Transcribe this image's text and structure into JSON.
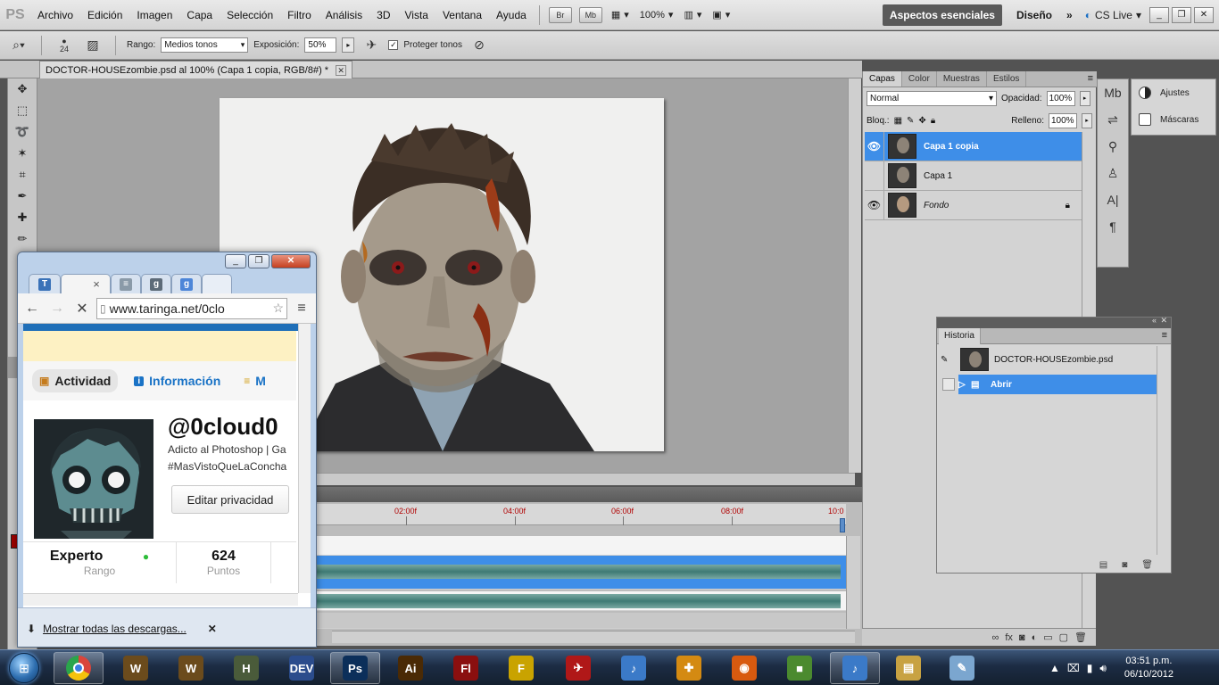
{
  "menubar": {
    "app_logo": "PS",
    "items": [
      "Archivo",
      "Edición",
      "Imagen",
      "Capa",
      "Selección",
      "Filtro",
      "Análisis",
      "3D",
      "Vista",
      "Ventana",
      "Ayuda"
    ],
    "bridge_label": "Br",
    "minibridge_label": "Mb",
    "zoom": "100%",
    "workspace_active": "Aspectos esenciales",
    "workspace_other": "Diseño",
    "more": "»",
    "cs_live": "CS Live"
  },
  "options": {
    "brush_size": "24",
    "range_label": "Rango:",
    "range_value": "Medios tonos",
    "exposure_label": "Exposición:",
    "exposure_value": "50%",
    "protect_label": "Proteger tonos",
    "protect_checked": "✓"
  },
  "document": {
    "tab_title": "DOCTOR-HOUSEzombie.psd al 100% (Capa 1 copia, RGB/8#) *"
  },
  "timeline": {
    "ticks": [
      "02:00f",
      "04:00f",
      "06:00f",
      "08:00f",
      "10:0"
    ]
  },
  "layers_panel": {
    "tabs": [
      "Capas",
      "Color",
      "Muestras",
      "Estilos"
    ],
    "blend_mode": "Normal",
    "opacity_label": "Opacidad:",
    "opacity_value": "100%",
    "lock_label": "Bloq.:",
    "fill_label": "Relleno:",
    "fill_value": "100%",
    "layers": [
      {
        "name": "Capa 1 copia",
        "visible": true,
        "selected": true
      },
      {
        "name": "Capa 1",
        "visible": false,
        "selected": false
      },
      {
        "name": "Fondo",
        "visible": true,
        "selected": false,
        "locked": true
      }
    ]
  },
  "adjust_panel": {
    "ajustes": "Ajustes",
    "mascaras": "Máscaras"
  },
  "history_panel": {
    "tab": "Historia",
    "snapshot": "DOCTOR-HOUSEzombie.psd",
    "steps": [
      "Abrir"
    ]
  },
  "chrome": {
    "url": "www.taringa.net/0clo",
    "tabs": [
      {
        "icon": "T",
        "color": "#3a72b8"
      },
      {
        "icon": "×",
        "color": "#f4f4f4"
      },
      {
        "icon": "≡",
        "color": "#8a9aa8"
      },
      {
        "icon": "g",
        "color": "#5d6b78"
      },
      {
        "icon": "g",
        "color": "#4d86d8"
      }
    ],
    "site_tabs": {
      "activity": "Actividad",
      "info": "Información",
      "more": "M"
    },
    "profile": {
      "username": "@0cloud0",
      "bio_line1": "Adicto al Photoshop | Ga",
      "bio_line2": "#MasVistoQueLaConcha",
      "edit_button": "Editar privacidad",
      "rank_value": "Experto",
      "rank_label": "Rango",
      "points_value": "624",
      "points_label": "Puntos"
    },
    "downloads_link": "Mostrar todas las descargas..."
  },
  "taskbar": {
    "apps": [
      {
        "name": "chrome",
        "label": "",
        "color": "#d9453b",
        "open": true
      },
      {
        "name": "wow-1",
        "label": "W",
        "color": "#6b4b1c",
        "open": false
      },
      {
        "name": "wow-2",
        "label": "W",
        "color": "#6b4b1c",
        "open": false
      },
      {
        "name": "halo",
        "label": "H",
        "color": "#4a5b3a",
        "open": false
      },
      {
        "name": "devcpp",
        "label": "DEV",
        "color": "#2b4c8c",
        "open": false
      },
      {
        "name": "photoshop",
        "label": "Ps",
        "color": "#0c2f5a",
        "open": true
      },
      {
        "name": "illustrator",
        "label": "Ai",
        "color": "#4a2a05",
        "open": false
      },
      {
        "name": "flash",
        "label": "Fl",
        "color": "#8a0f0f",
        "open": false
      },
      {
        "name": "fraps",
        "label": "F",
        "color": "#c9a300",
        "open": false
      },
      {
        "name": "red-app",
        "label": "✈",
        "color": "#b01818",
        "open": false
      },
      {
        "name": "itunes-1",
        "label": "♪",
        "color": "#3b7ac8",
        "open": false
      },
      {
        "name": "gamepad",
        "label": "✚",
        "color": "#d48a12",
        "open": false
      },
      {
        "name": "firefox",
        "label": "◉",
        "color": "#d85a0f",
        "open": false
      },
      {
        "name": "minecraft",
        "label": "■",
        "color": "#4b8a2f",
        "open": false
      },
      {
        "name": "itunes-2",
        "label": "♪",
        "color": "#3b7ac8",
        "open": true
      },
      {
        "name": "explorer",
        "label": "▤",
        "color": "#c8a242",
        "open": false
      },
      {
        "name": "paint",
        "label": "✎",
        "color": "#7ba6cf",
        "open": false
      }
    ],
    "time": "03:51 p.m.",
    "date": "06/10/2012"
  }
}
